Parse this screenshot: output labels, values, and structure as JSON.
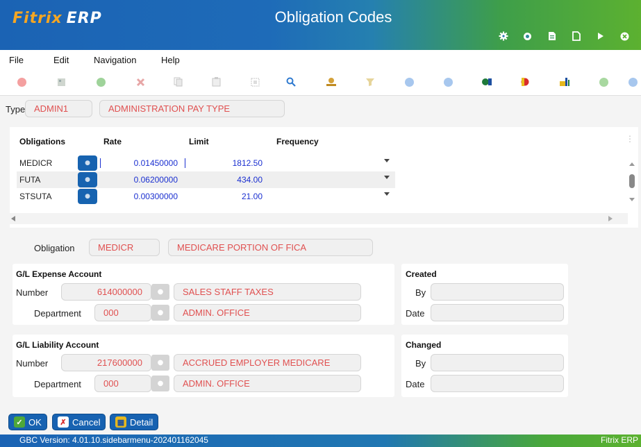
{
  "app": {
    "logo_brand": "Fitrix",
    "logo_suffix": "ERP",
    "window_title": "Obligation Codes",
    "title_icons": [
      "gear-icon",
      "circle-icon",
      "document-icon",
      "new-page-icon",
      "play-icon",
      "close-icon"
    ]
  },
  "menu": [
    "File",
    "Edit",
    "Navigation",
    "Help"
  ],
  "toolbar": {
    "icons": [
      "power-icon",
      "grid-icon",
      "accept-icon",
      "cancel-icon",
      "copy-icon",
      "paste-icon",
      "select-all-icon",
      "search-icon",
      "person-icon",
      "filter-icon",
      "arrow-down-icon",
      "arrow-up-icon",
      "add-row-icon",
      "delete-row-icon",
      "detail-icon",
      "check-icon",
      "help-icon"
    ]
  },
  "type_row": {
    "label": "Type",
    "code": "ADMIN1",
    "description": "ADMINISTRATION PAY TYPE"
  },
  "grid": {
    "headers": [
      "Obligations",
      "Rate",
      "Limit",
      "Frequency"
    ],
    "rows": [
      {
        "obligation": "MEDICR",
        "rate": "0.01450000",
        "limit": "1812.50",
        "frequency": ""
      },
      {
        "obligation": "FUTA",
        "rate": "0.06200000",
        "limit": "434.00",
        "frequency": ""
      },
      {
        "obligation": "STSUTA",
        "rate": "0.00300000",
        "limit": "21.00",
        "frequency": ""
      }
    ]
  },
  "obligation": {
    "label": "Obligation",
    "code": "MEDICR",
    "description": "MEDICARE PORTION OF FICA"
  },
  "expense": {
    "title": "G/L Expense Account",
    "number_label": "Number",
    "number": "614000000",
    "number_desc": "SALES STAFF TAXES",
    "dept_label": "Department",
    "dept": "000",
    "dept_desc": "ADMIN. OFFICE"
  },
  "liability": {
    "title": "G/L Liability Account",
    "number_label": "Number",
    "number": "217600000",
    "number_desc": "ACCRUED EMPLOYER MEDICARE",
    "dept_label": "Department",
    "dept": "000",
    "dept_desc": "ADMIN. OFFICE"
  },
  "created": {
    "title": "Created",
    "by_label": "By",
    "by": "",
    "date_label": "Date",
    "date": ""
  },
  "changed": {
    "title": "Changed",
    "by_label": "By",
    "by": "",
    "date_label": "Date",
    "date": ""
  },
  "buttons": {
    "ok": "OK",
    "cancel": "Cancel",
    "detail": "Detail"
  },
  "status": {
    "version": "GBC Version: 4.01.10.sidebarmenu-202401162045",
    "brand": "Fitrix ERP"
  },
  "colors": {
    "primary_blue": "#1762b1",
    "accent_green": "#5cb130",
    "field_text_red": "#e05050",
    "number_blue": "#1a2fd0"
  }
}
